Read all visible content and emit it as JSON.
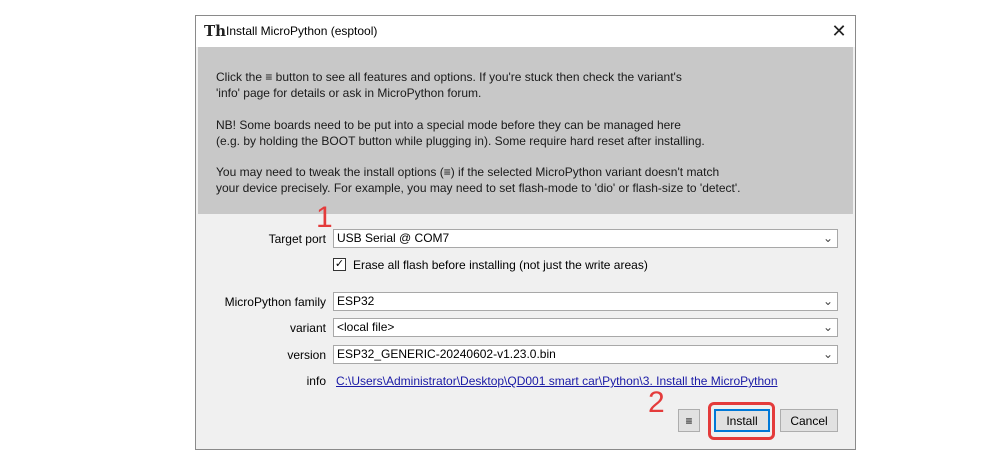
{
  "window": {
    "title": "Install MicroPython (esptool)",
    "close_glyph": "✕"
  },
  "info": {
    "para1_l1": "Click the ≡ button to see all features and options. If you're stuck then check the variant's",
    "para1_l2": "'info' page for details or ask in MicroPython forum.",
    "para2_l1": "NB! Some boards need to be put into a special mode before they can be managed here",
    "para2_l2": "(e.g. by holding the BOOT button while plugging in). Some require hard reset after installing.",
    "para3_l1": "You may need to tweak the install options (≡) if the selected MicroPython variant doesn't match",
    "para3_l2": "your device precisely. For example, you may need to set flash-mode to 'dio' or flash-size to 'detect'."
  },
  "form": {
    "target_port_label": "Target port",
    "target_port_value": "USB Serial @ COM7",
    "erase_checked": true,
    "erase_label": "Erase all flash before installing (not just the write areas)",
    "family_label": "MicroPython family",
    "family_value": "ESP32",
    "variant_label": "variant",
    "variant_value": "<local file>",
    "version_label": "version",
    "version_value": "ESP32_GENERIC-20240602-v1.23.0.bin",
    "info_label": "info",
    "info_link": "C:\\Users\\Administrator\\Desktop\\QD001 smart car\\Python\\3. Install the MicroPython",
    "chevron_glyph": "⌄",
    "check_glyph": "✓"
  },
  "buttons": {
    "menu_glyph": "≡",
    "install": "Install",
    "cancel": "Cancel"
  },
  "annotations": {
    "step1": "1",
    "step2": "2",
    "color": "#e43b3b"
  }
}
